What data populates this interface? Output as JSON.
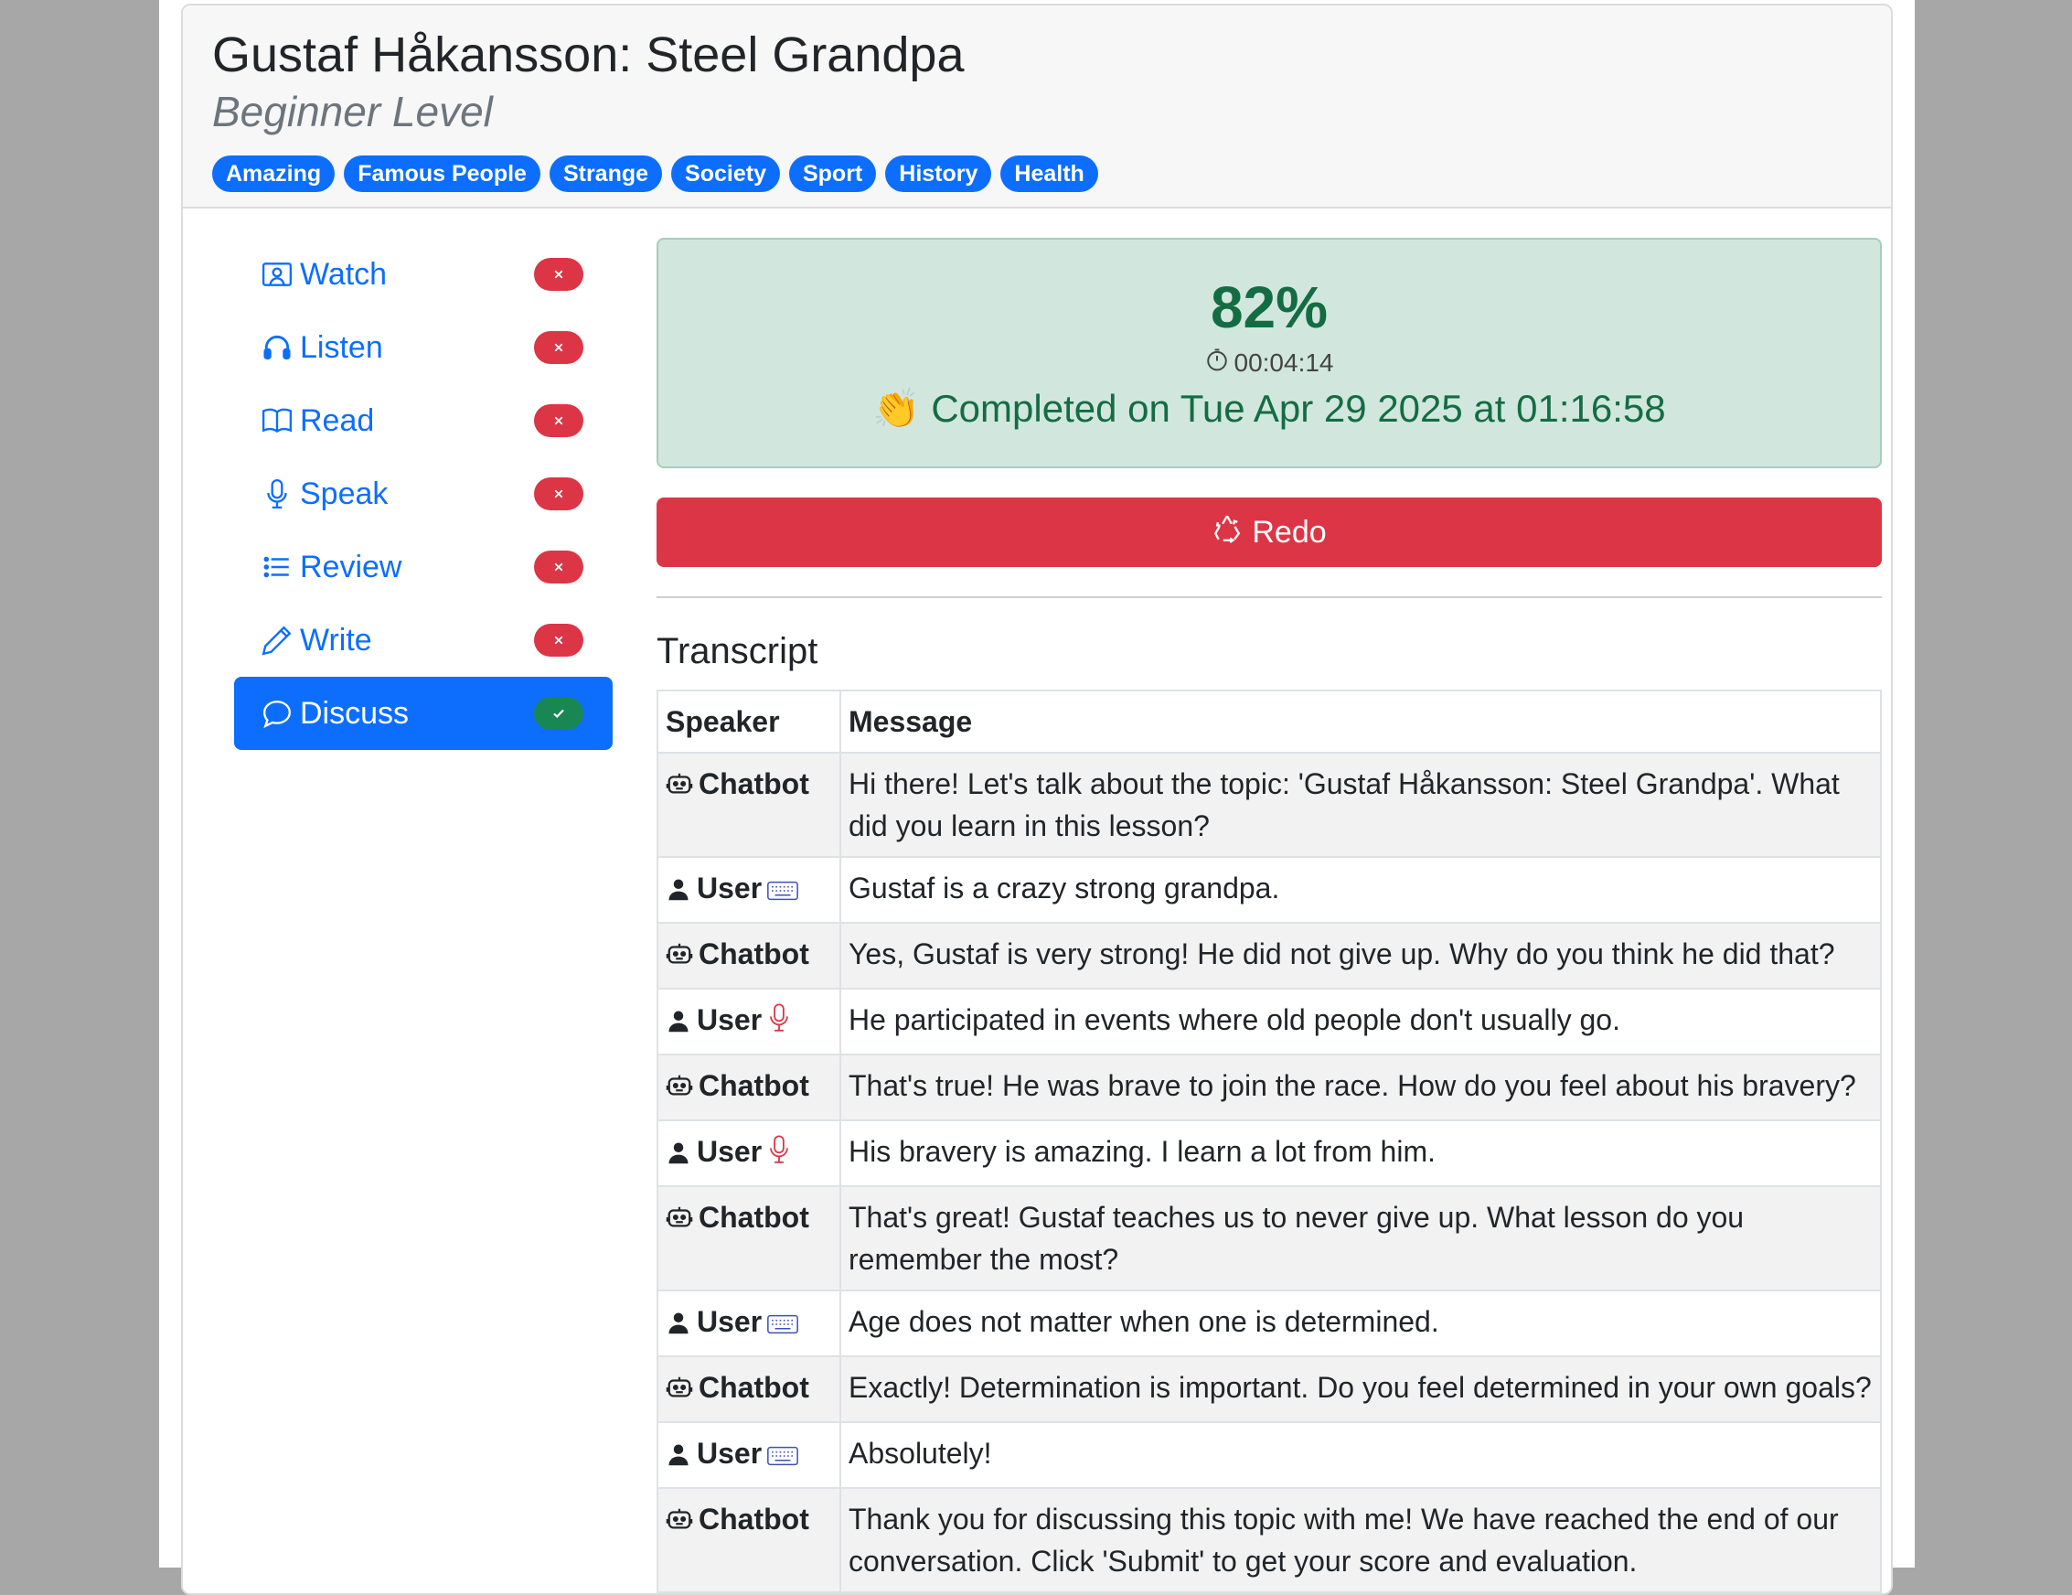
{
  "header": {
    "title": "Gustaf Håkansson: Steel Grandpa",
    "level": "Beginner Level",
    "tags": [
      "Amazing",
      "Famous People",
      "Strange",
      "Society",
      "Sport",
      "History",
      "Health"
    ]
  },
  "sidebar": {
    "items": [
      {
        "label": "Watch",
        "icon": "video-icon",
        "status": "incomplete"
      },
      {
        "label": "Listen",
        "icon": "headphones-icon",
        "status": "incomplete"
      },
      {
        "label": "Read",
        "icon": "book-icon",
        "status": "incomplete"
      },
      {
        "label": "Speak",
        "icon": "microphone-icon",
        "status": "incomplete"
      },
      {
        "label": "Review",
        "icon": "list-icon",
        "status": "incomplete"
      },
      {
        "label": "Write",
        "icon": "pencil-icon",
        "status": "incomplete"
      },
      {
        "label": "Discuss",
        "icon": "chat-icon",
        "status": "complete",
        "active": true
      }
    ]
  },
  "result": {
    "score": "82%",
    "duration": "00:04:14",
    "completed": "👏 Completed on Tue Apr 29 2025 at 01:16:58"
  },
  "redo_label": "Redo",
  "transcript": {
    "title": "Transcript",
    "columns": [
      "Speaker",
      "Message"
    ],
    "rows": [
      {
        "speaker": "Chatbot",
        "input": "",
        "message": "Hi there! Let's talk about the topic: 'Gustaf Håkansson: Steel Grandpa'. What did you learn in this lesson?"
      },
      {
        "speaker": "User",
        "input": "keyboard",
        "message": "Gustaf is a crazy strong grandpa."
      },
      {
        "speaker": "Chatbot",
        "input": "",
        "message": "Yes, Gustaf is very strong! He did not give up. Why do you think he did that?"
      },
      {
        "speaker": "User",
        "input": "microphone",
        "message": "He participated in events where old people don't usually go."
      },
      {
        "speaker": "Chatbot",
        "input": "",
        "message": "That's true! He was brave to join the race. How do you feel about his bravery?"
      },
      {
        "speaker": "User",
        "input": "microphone",
        "message": "His bravery is amazing. I learn a lot from him."
      },
      {
        "speaker": "Chatbot",
        "input": "",
        "message": "That's great! Gustaf teaches us to never give up. What lesson do you remember the most?"
      },
      {
        "speaker": "User",
        "input": "keyboard",
        "message": "Age does not matter when one is determined."
      },
      {
        "speaker": "Chatbot",
        "input": "",
        "message": "Exactly! Determination is important. Do you feel determined in your own goals?"
      },
      {
        "speaker": "User",
        "input": "keyboard",
        "message": "Absolutely!"
      },
      {
        "speaker": "Chatbot",
        "input": "",
        "message": "Thank you for discussing this topic with me! We have reached the end of our conversation. Click 'Submit' to get your score and evaluation."
      }
    ]
  },
  "colors": {
    "primary": "#0d6efd",
    "danger": "#dc3545",
    "success": "#198754",
    "success_bg": "#d1e7dd",
    "success_text": "#146c43"
  }
}
